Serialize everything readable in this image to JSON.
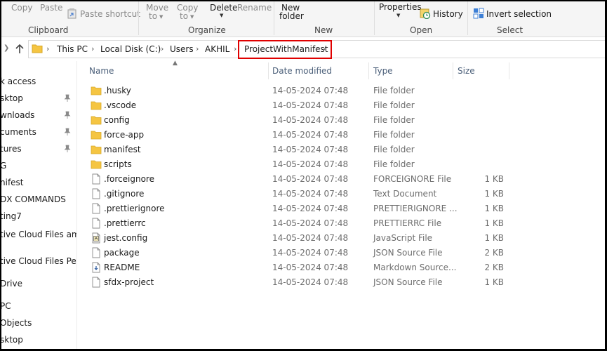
{
  "ribbon": {
    "clipboard": {
      "copy": "Copy",
      "paste": "Paste",
      "paste_shortcut": "Paste shortcut",
      "group": "Clipboard"
    },
    "organize": {
      "move_to": [
        "Move",
        "to"
      ],
      "copy_to": [
        "Copy",
        "to"
      ],
      "delete": "Delete",
      "rename": "Rename",
      "group": "Organize"
    },
    "new": {
      "new_folder": [
        "New",
        "folder"
      ],
      "group": "New"
    },
    "open": {
      "properties": "Properties",
      "history": "History",
      "group": "Open"
    },
    "select": {
      "invert_selection": "Invert selection",
      "group": "Select"
    }
  },
  "address": {
    "crumbs": [
      "This PC",
      "Local Disk (C:)",
      "Users",
      "AKHIL",
      "ProjectWithManifest"
    ],
    "highlight_color": "#e00000"
  },
  "nav": {
    "items": [
      {
        "label": "k access",
        "pinned": false
      },
      {
        "label": "sktop",
        "pinned": true
      },
      {
        "label": "wnloads",
        "pinned": true
      },
      {
        "label": "cuments",
        "pinned": true
      },
      {
        "label": "tures",
        "pinned": true
      },
      {
        "label": "G",
        "pinned": false
      },
      {
        "label": "nifest",
        "pinned": false
      },
      {
        "label": "DX COMMANDS",
        "pinned": false
      },
      {
        "label": "ting7",
        "pinned": false
      },
      {
        "label": "tive Cloud Files  am",
        "pinned": false
      },
      {
        "label": "tive Cloud Files Pers",
        "pinned": false
      },
      {
        "label": "Drive",
        "pinned": false
      },
      {
        "label": "PC",
        "pinned": false
      },
      {
        "label": "Objects",
        "pinned": false
      },
      {
        "label": "sktop",
        "pinned": false
      }
    ]
  },
  "columns": {
    "name": "Name",
    "date": "Date modified",
    "type": "Type",
    "size": "Size"
  },
  "files": [
    {
      "name": ".husky",
      "date": "14-05-2024 07:48",
      "type": "File folder",
      "size": "",
      "icon": "folder-icon"
    },
    {
      "name": ".vscode",
      "date": "14-05-2024 07:48",
      "type": "File folder",
      "size": "",
      "icon": "folder-icon"
    },
    {
      "name": "config",
      "date": "14-05-2024 07:48",
      "type": "File folder",
      "size": "",
      "icon": "folder-icon"
    },
    {
      "name": "force-app",
      "date": "14-05-2024 07:48",
      "type": "File folder",
      "size": "",
      "icon": "folder-icon"
    },
    {
      "name": "manifest",
      "date": "14-05-2024 07:48",
      "type": "File folder",
      "size": "",
      "icon": "folder-icon"
    },
    {
      "name": "scripts",
      "date": "14-05-2024 07:48",
      "type": "File folder",
      "size": "",
      "icon": "folder-icon"
    },
    {
      "name": ".forceignore",
      "date": "14-05-2024 07:48",
      "type": "FORCEIGNORE File",
      "size": "1 KB",
      "icon": "file-icon"
    },
    {
      "name": ".gitignore",
      "date": "14-05-2024 07:48",
      "type": "Text Document",
      "size": "1 KB",
      "icon": "file-icon"
    },
    {
      "name": ".prettierignore",
      "date": "14-05-2024 07:48",
      "type": "PRETTIERIGNORE ...",
      "size": "1 KB",
      "icon": "file-icon"
    },
    {
      "name": ".prettierrc",
      "date": "14-05-2024 07:48",
      "type": "PRETTIERRC File",
      "size": "1 KB",
      "icon": "file-icon"
    },
    {
      "name": "jest.config",
      "date": "14-05-2024 07:48",
      "type": "JavaScript File",
      "size": "1 KB",
      "icon": "script-file-icon"
    },
    {
      "name": "package",
      "date": "14-05-2024 07:48",
      "type": "JSON Source File",
      "size": "2 KB",
      "icon": "file-icon"
    },
    {
      "name": "README",
      "date": "14-05-2024 07:48",
      "type": "Markdown Source...",
      "size": "2 KB",
      "icon": "markdown-file-icon"
    },
    {
      "name": "sfdx-project",
      "date": "14-05-2024 07:48",
      "type": "JSON Source File",
      "size": "1 KB",
      "icon": "file-icon"
    }
  ],
  "colors": {
    "folder": "#f5c542",
    "column_header": "#4c607a",
    "secondary_text": "#6d6d6d"
  }
}
